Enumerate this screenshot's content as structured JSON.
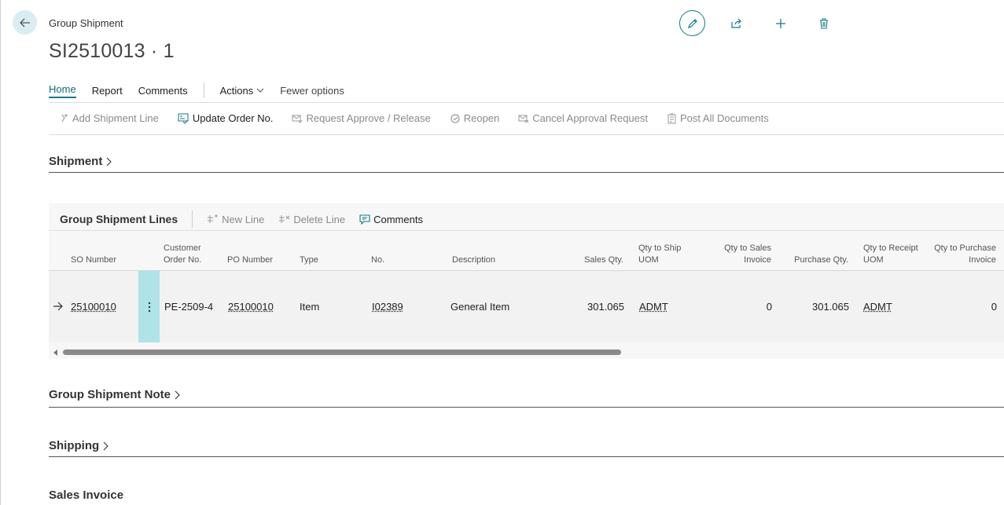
{
  "header": {
    "caption": "Group Shipment",
    "title": "SI2510013 · 1",
    "icons": [
      "edit-icon",
      "share-icon",
      "plus-icon",
      "delete-icon"
    ]
  },
  "tabs": [
    {
      "label": "Home",
      "active": true
    },
    {
      "label": "Report"
    },
    {
      "label": "Comments"
    },
    {
      "label": "Actions"
    },
    {
      "label": "Fewer options"
    }
  ],
  "actions": [
    {
      "label": "Add Shipment Line",
      "enabled": false
    },
    {
      "label": "Update Order No.",
      "enabled": true
    },
    {
      "label": "Request Approve / Release",
      "enabled": false
    },
    {
      "label": "Reopen",
      "enabled": false
    },
    {
      "label": "Cancel Approval Request",
      "enabled": false
    },
    {
      "label": "Post All Documents",
      "enabled": false
    }
  ],
  "sections": {
    "shipment": "Shipment",
    "note": "Group Shipment Note",
    "shipping": "Shipping",
    "sales_invoice": "Sales Invoice"
  },
  "lines": {
    "title": "Group Shipment Lines",
    "actions": [
      {
        "label": "New Line",
        "enabled": false
      },
      {
        "label": "Delete Line",
        "enabled": false
      },
      {
        "label": "Comments",
        "enabled": true
      }
    ],
    "columns": {
      "so_number": "SO Number",
      "customer_order_1": "Customer",
      "customer_order_2": "Order No.",
      "po_number": "PO Number",
      "type": "Type",
      "no": "No.",
      "description": "Description",
      "sales_qty": "Sales Qty.",
      "qty_ship_uom_1": "Qty to Ship",
      "qty_ship_uom_2": "UOM",
      "qty_sales_inv_1": "Qty to Sales",
      "qty_sales_inv_2": "Invoice",
      "purchase_qty": "Purchase Qty.",
      "qty_receipt_uom_1": "Qty to Receipt",
      "qty_receipt_uom_2": "UOM",
      "qty_purch_inv_1": "Qty to Purchase",
      "qty_purch_inv_2": "Invoice"
    },
    "row": {
      "so_number": "25100010",
      "customer_order_no": "PE-2509-4",
      "po_number": "25100010",
      "type": "Item",
      "no": "I02389",
      "description": "General Item",
      "sales_qty": "301.065",
      "qty_ship_uom": "ADMT",
      "qty_sales_invoice": "0",
      "purchase_qty": "301.065",
      "qty_receipt_uom": "ADMT",
      "qty_purchase_invoice": "0"
    }
  }
}
